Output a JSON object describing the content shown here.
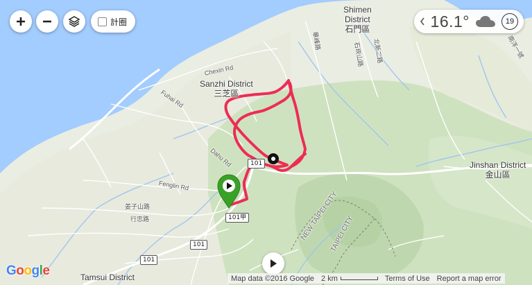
{
  "controls": {
    "zoom_in_icon": "plus-icon",
    "zoom_out_icon": "minus-icon",
    "layers_icon": "layers-icon",
    "toggle_label": "計圈"
  },
  "weather": {
    "temperature": "16.1°",
    "condition_icon": "cloud-icon",
    "wind_speed": "19"
  },
  "places": {
    "shimen_en": "Shimen",
    "shimen_en2": "District",
    "shimen_zh": "石門區",
    "sanzhi_en": "Sanzhi District",
    "sanzhi_zh": "三芝區",
    "jinshan_en": "Jinshan District",
    "jinshan_zh": "金山區",
    "tamsui_en": "Tamsui District",
    "new_taipei": "NEW TAIPEI CITY",
    "taipei": "TAIPEI CITY"
  },
  "roads": {
    "chexin": "Chexin Rd",
    "fuhai": "Fuhai Rd",
    "dahu": "Dahu Rd",
    "fenglin": "Fenglin Rd",
    "shield_101": "101",
    "shield_101a": "101甲",
    "shield_101_lower": "101",
    "zh_1": "華峰路",
    "zh_2": "石崁山路",
    "zh_3": "北新二路",
    "zh_4": "姜子山路",
    "zh_5": "行忠路",
    "zh_6": "南洋一號"
  },
  "attribution": {
    "map_data": "Map data ©2016 Google",
    "scale": "2 km",
    "terms": "Terms of Use",
    "report": "Report a map error",
    "logo": "Google"
  },
  "colors": {
    "sea": "#a3ccff",
    "land": "#e8ecdf",
    "forest": "#cfe3c2",
    "route": "#ec2d55",
    "start_marker": "#3aa128"
  }
}
